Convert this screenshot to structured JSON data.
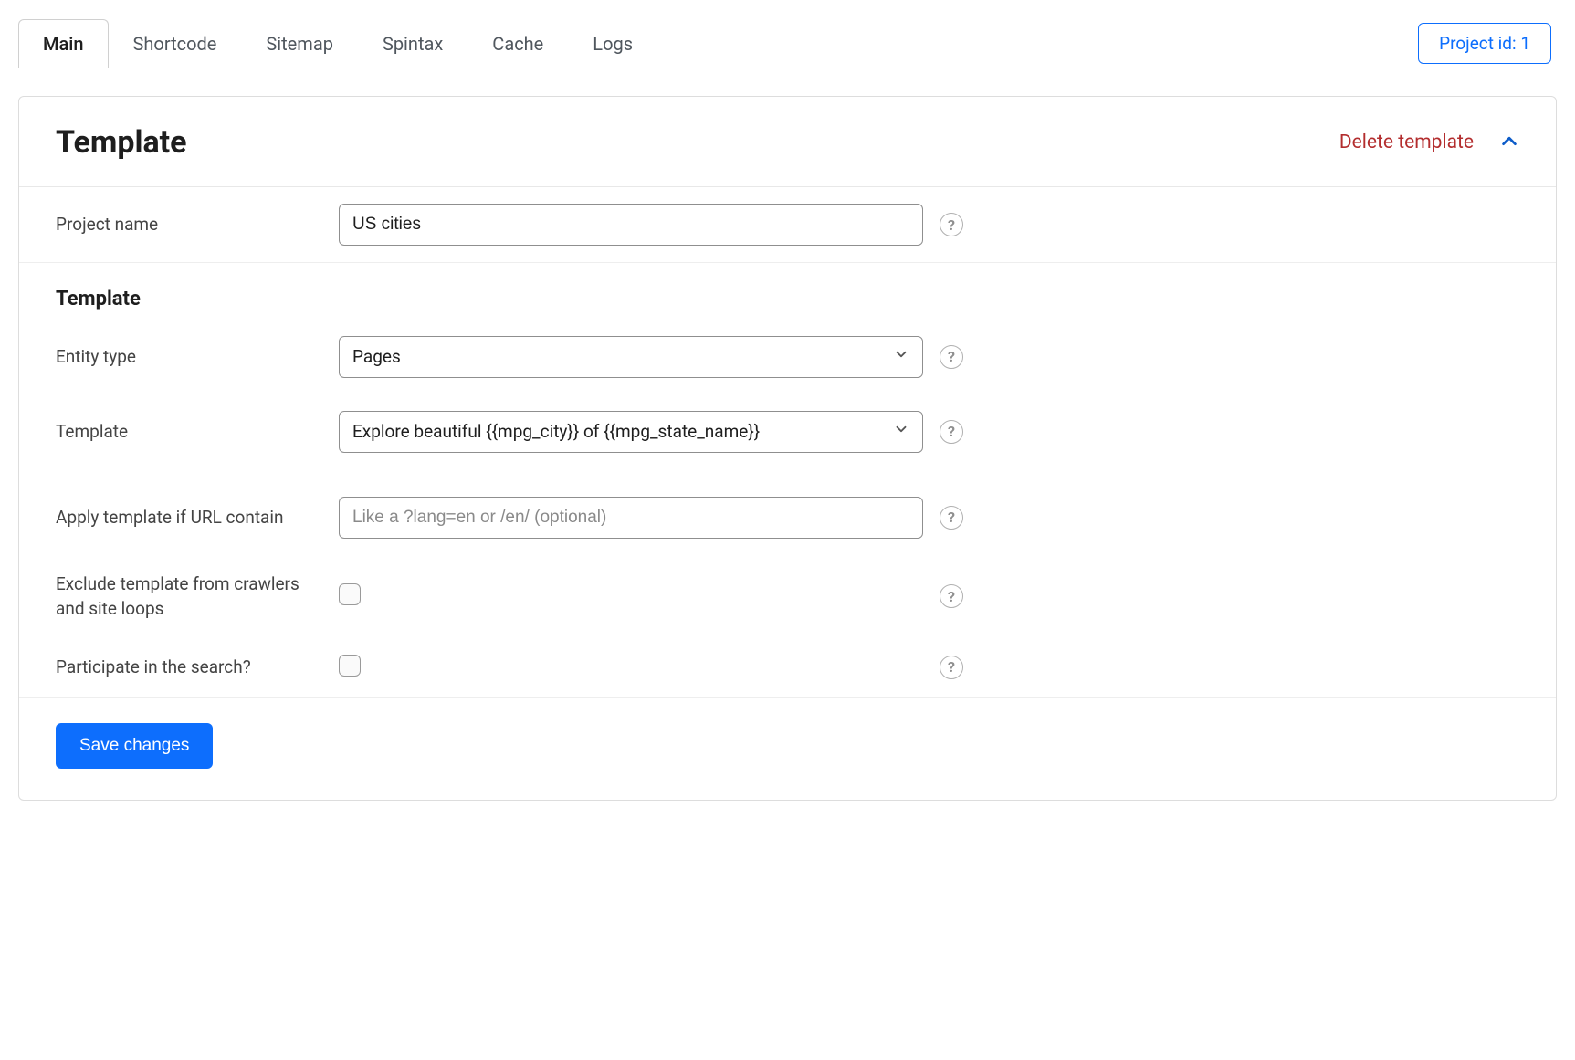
{
  "tabs": {
    "items": [
      {
        "label": "Main",
        "active": true
      },
      {
        "label": "Shortcode",
        "active": false
      },
      {
        "label": "Sitemap",
        "active": false
      },
      {
        "label": "Spintax",
        "active": false
      },
      {
        "label": "Cache",
        "active": false
      },
      {
        "label": "Logs",
        "active": false
      }
    ],
    "project_id_label": "Project id: 1"
  },
  "panel": {
    "title": "Template",
    "delete_label": "Delete template"
  },
  "form": {
    "project_name": {
      "label": "Project name",
      "value": "US cities"
    },
    "subheading": "Template",
    "entity_type": {
      "label": "Entity type",
      "selected": "Pages"
    },
    "template": {
      "label": "Template",
      "selected": "Explore beautiful {{mpg_city}} of {{mpg_state_name}}"
    },
    "url_contain": {
      "label": "Apply template if URL contain",
      "placeholder": "Like a ?lang=en or /en/ (optional)",
      "value": ""
    },
    "exclude": {
      "label": "Exclude template from crawlers and site loops",
      "checked": false
    },
    "participate": {
      "label": "Participate in the search?",
      "checked": false
    }
  },
  "actions": {
    "save_label": "Save changes"
  }
}
